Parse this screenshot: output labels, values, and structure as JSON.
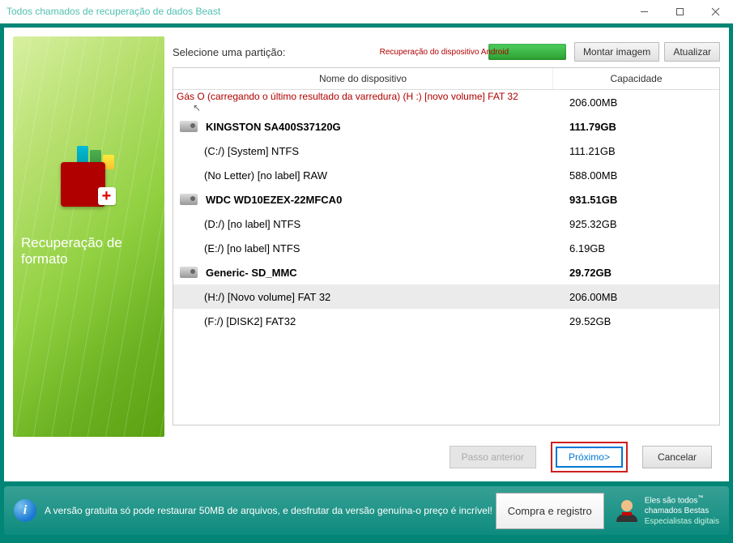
{
  "window": {
    "title": "Todos chamados de recuperação de dados Beast"
  },
  "left": {
    "heading": "Recuperação de formato"
  },
  "main": {
    "select_label": "Selecione uma partição:",
    "android_link": "Recuperação do dispositivo Android",
    "mount_btn": "Montar imagem",
    "update_btn": "Atualizar",
    "columns": {
      "name": "Nome do dispositivo",
      "capacity": "Capacidade"
    },
    "top_info": {
      "text": "Gás O (carregando o último resultado da varredura) (H :) [novo volume] FAT 32",
      "capacity": "206.00MB"
    },
    "rows": [
      {
        "type": "disk",
        "name": "KINGSTON SA400S37120G",
        "cap": "111.79GB"
      },
      {
        "type": "part",
        "name": "(C:/) [System] NTFS",
        "cap": "111.21GB"
      },
      {
        "type": "part",
        "name": "(No Letter) [no label] RAW",
        "cap": "588.00MB"
      },
      {
        "type": "disk",
        "name": "WDC WD10EZEX-22MFCA0",
        "cap": "931.51GB"
      },
      {
        "type": "part",
        "name": "(D:/) [no label] NTFS",
        "cap": "925.32GB"
      },
      {
        "type": "part",
        "name": "(E:/) [no label] NTFS",
        "cap": "6.19GB"
      },
      {
        "type": "disk",
        "name": "Generic- SD_MMC",
        "cap": "29.72GB"
      },
      {
        "type": "part",
        "name": "(H:/) [Novo volume] FAT 32",
        "cap": "206.00MB",
        "selected": true
      },
      {
        "type": "part",
        "name": "(F:/) [DISK2] FAT32",
        "cap": "29.52GB"
      }
    ]
  },
  "footer": {
    "prev": "Passo anterior",
    "next": "Próximo>",
    "cancel": "Cancelar"
  },
  "bottom": {
    "free_text": "A versão gratuita só pode restaurar 50MB de arquivos, e desfrutar da versão genuína-o preço é incrível!",
    "buy_btn": "Compra e registro",
    "slogan1": "Eles são todos",
    "slogan2": "chamados Bestas",
    "slogan3": "Especialistas digitais"
  }
}
